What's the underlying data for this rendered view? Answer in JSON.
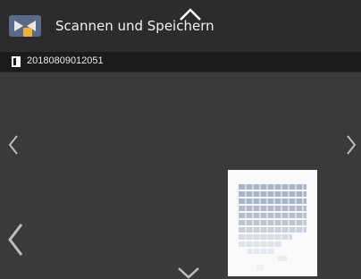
{
  "header": {
    "title": "Scannen und Speichern"
  },
  "document": {
    "id": "20180809012051"
  },
  "icons": {
    "app": "scan-and-store-icon",
    "document": "document-icon",
    "up": "chevron-up-icon",
    "down": "chevron-down-icon",
    "prev": "chevron-left-icon",
    "next": "chevron-right-icon"
  },
  "colors": {
    "header_bg": "#2c2c2c",
    "info_bg": "#1b1b1b",
    "canvas_bg": "#3a3a3a",
    "chevron": "#bdbdbd",
    "preview_grid": "#a8b4c8"
  }
}
